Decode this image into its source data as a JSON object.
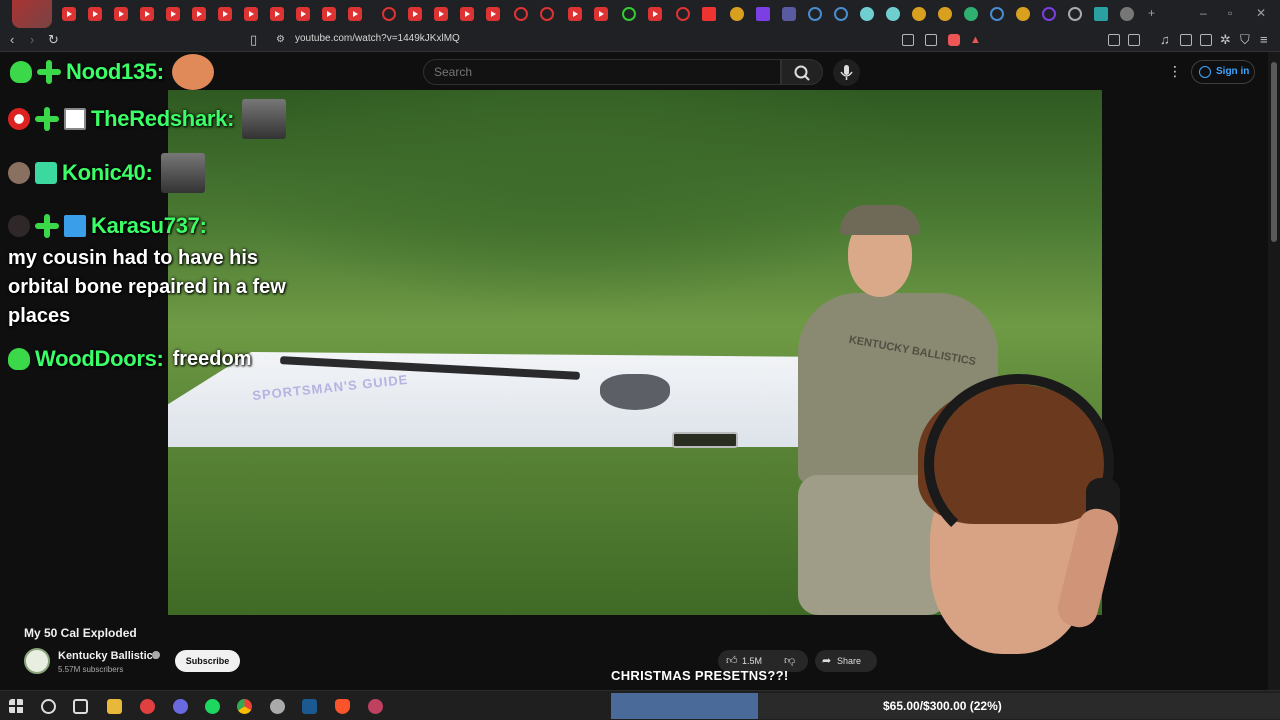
{
  "browser": {
    "url": "youtube.com/watch?v=1449kJKxlMQ"
  },
  "youtube": {
    "search_placeholder": "Search",
    "signin_label": "Sign in",
    "video_title": "My 50 Cal Exploded",
    "channel_name": "Kentucky Ballistics",
    "channel_subs": "5.57M subscribers",
    "subscribe_label": "Subscribe",
    "like_count": "1.5M",
    "share_label": "Share",
    "table_text": "SPORTSMAN'S GUIDE",
    "shirt_text": "KENTUCKY BALLISTICS"
  },
  "chat": [
    {
      "name": "Nood135:",
      "message": ""
    },
    {
      "name": "TheRedshark:",
      "message": ""
    },
    {
      "name": "Konic40:",
      "message": ""
    },
    {
      "name": "Karasu737:",
      "message": "my cousin had to have his orbital bone repaired in a few places"
    },
    {
      "name": "WoodDoors:",
      "message": "freedom"
    }
  ],
  "stream_overlay": {
    "poll_text": "CHRISTMAS PRESETNS??!",
    "goal_text": "$65.00/$300.00 (22%)",
    "goal_fraction": 0.22
  },
  "colors": {
    "chat_name": "#3bff66",
    "youtube_bg": "#0f0f0f",
    "signin_blue": "#3ea6ff"
  }
}
